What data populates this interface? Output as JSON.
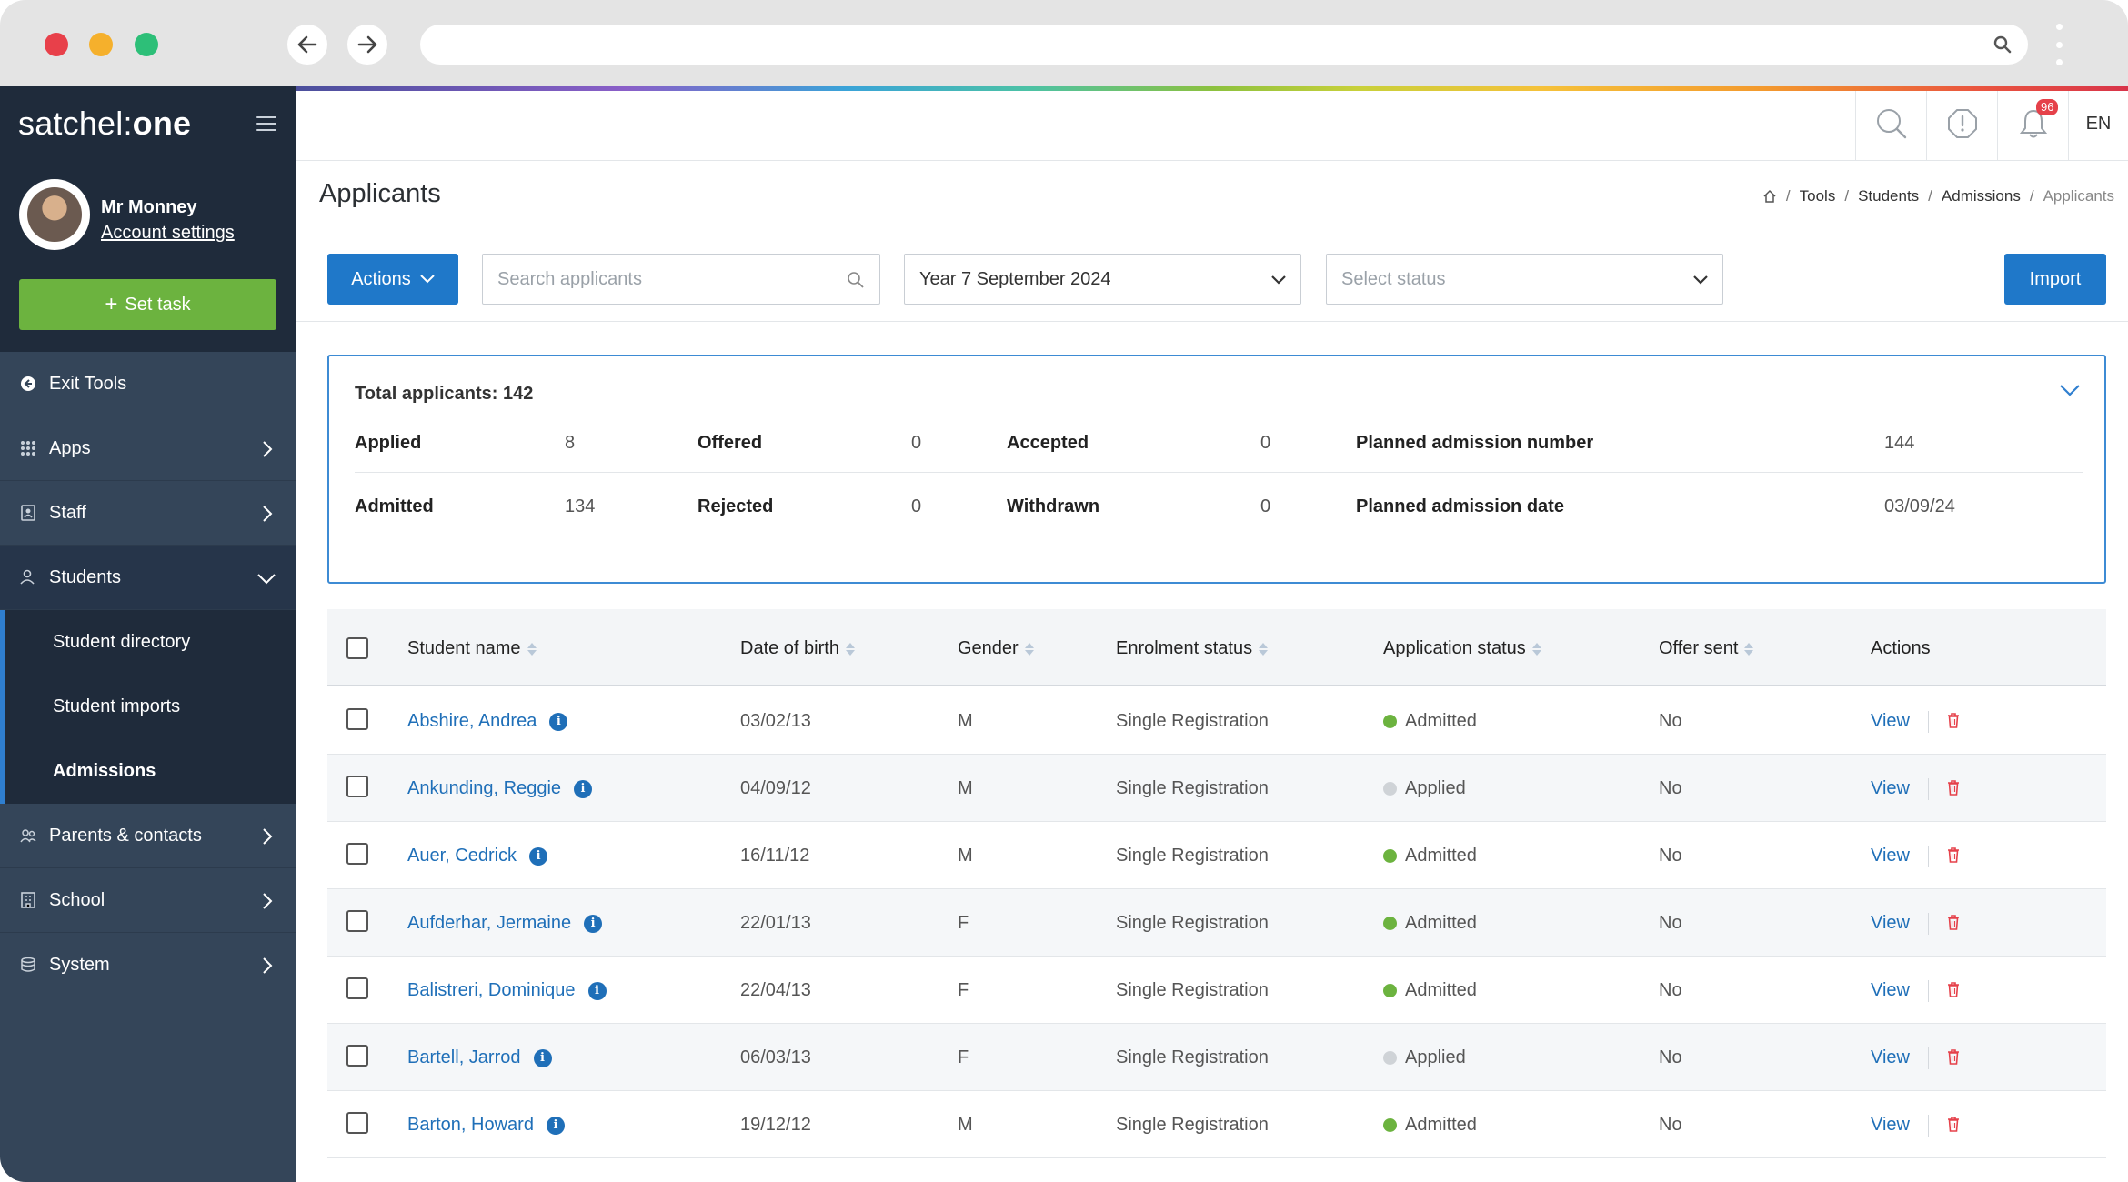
{
  "app": {
    "brand_prefix": "satchel:",
    "brand_suffix": "one",
    "user_name": "Mr Monney",
    "account_link": "Account settings",
    "set_task_label": "Set task",
    "notification_count": "96",
    "language": "EN"
  },
  "sidebar": {
    "items": [
      {
        "label": "Exit Tools",
        "icon": "arrow-left-circle-icon"
      },
      {
        "label": "Apps",
        "icon": "apps-grid-icon"
      },
      {
        "label": "Staff",
        "icon": "staff-icon"
      },
      {
        "label": "Students",
        "icon": "students-icon"
      },
      {
        "label": "Parents & contacts",
        "icon": "parents-icon"
      },
      {
        "label": "School",
        "icon": "school-icon"
      },
      {
        "label": "System",
        "icon": "system-icon"
      }
    ],
    "students_sub": [
      {
        "label": "Student directory"
      },
      {
        "label": "Student imports"
      },
      {
        "label": "Admissions"
      }
    ]
  },
  "page": {
    "title": "Applicants",
    "breadcrumb": [
      "Tools",
      "Students",
      "Admissions",
      "Applicants"
    ]
  },
  "toolbar": {
    "actions_label": "Actions",
    "search_placeholder": "Search applicants",
    "year_value": "Year 7 September 2024",
    "status_placeholder": "Select status",
    "import_label": "Import"
  },
  "summary": {
    "total_label": "Total applicants: 142",
    "applied_label": "Applied",
    "applied": "8",
    "offered_label": "Offered",
    "offered": "0",
    "accepted_label": "Accepted",
    "accepted": "0",
    "pan_label": "Planned admission number",
    "pan": "144",
    "admitted_label": "Admitted",
    "admitted": "134",
    "rejected_label": "Rejected",
    "rejected": "0",
    "withdrawn_label": "Withdrawn",
    "withdrawn": "0",
    "pad_label": "Planned admission date",
    "pad": "03/09/24"
  },
  "table": {
    "columns": [
      "Student name",
      "Date of birth",
      "Gender",
      "Enrolment status",
      "Application status",
      "Offer sent",
      "Actions"
    ],
    "view_label": "View",
    "status_colors": {
      "Admitted": "#6cb33f",
      "Applied": "#cfd3d7"
    },
    "rows": [
      {
        "name": "Abshire, Andrea",
        "dob": "03/02/13",
        "gender": "M",
        "enrolment": "Single Registration",
        "status": "Admitted",
        "offer": "No"
      },
      {
        "name": "Ankunding, Reggie",
        "dob": "04/09/12",
        "gender": "M",
        "enrolment": "Single Registration",
        "status": "Applied",
        "offer": "No"
      },
      {
        "name": "Auer, Cedrick",
        "dob": "16/11/12",
        "gender": "M",
        "enrolment": "Single Registration",
        "status": "Admitted",
        "offer": "No"
      },
      {
        "name": "Aufderhar, Jermaine",
        "dob": "22/01/13",
        "gender": "F",
        "enrolment": "Single Registration",
        "status": "Admitted",
        "offer": "No"
      },
      {
        "name": "Balistreri, Dominique",
        "dob": "22/04/13",
        "gender": "F",
        "enrolment": "Single Registration",
        "status": "Admitted",
        "offer": "No"
      },
      {
        "name": "Bartell, Jarrod",
        "dob": "06/03/13",
        "gender": "F",
        "enrolment": "Single Registration",
        "status": "Applied",
        "offer": "No"
      },
      {
        "name": "Barton, Howard",
        "dob": "19/12/12",
        "gender": "M",
        "enrolment": "Single Registration",
        "status": "Admitted",
        "offer": "No"
      }
    ]
  }
}
